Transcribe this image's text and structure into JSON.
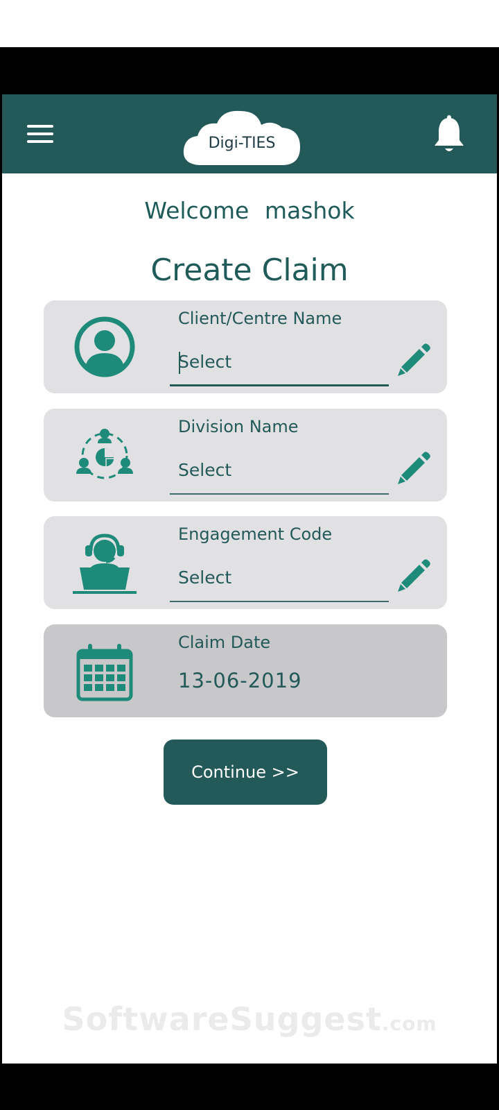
{
  "header": {
    "logo_text": "Digi-TIES",
    "menu_icon": "hamburger-menu-icon",
    "bell_icon": "bell-icon"
  },
  "welcome": {
    "greeting": "Welcome",
    "username": "mashok"
  },
  "page_title": "Create Claim",
  "fields": {
    "client": {
      "label": "Client/Centre Name",
      "value": "Select",
      "icon": "user-circle-icon"
    },
    "division": {
      "label": "Division Name",
      "value": "Select",
      "icon": "team-network-icon"
    },
    "engagement": {
      "label": "Engagement Code",
      "value": "Select",
      "icon": "headset-agent-icon"
    },
    "claim_date": {
      "label": "Claim Date",
      "value": "13-06-2019",
      "icon": "calendar-icon"
    }
  },
  "continue_label": "Continue >>",
  "watermark": {
    "main": "SoftwareSuggest",
    "suffix": ".com"
  },
  "colors": {
    "primary": "#235a59",
    "card_bg": "#e1e1e3",
    "card_disabled_bg": "#c8c8ca",
    "icon_teal": "#1e8a7a"
  }
}
